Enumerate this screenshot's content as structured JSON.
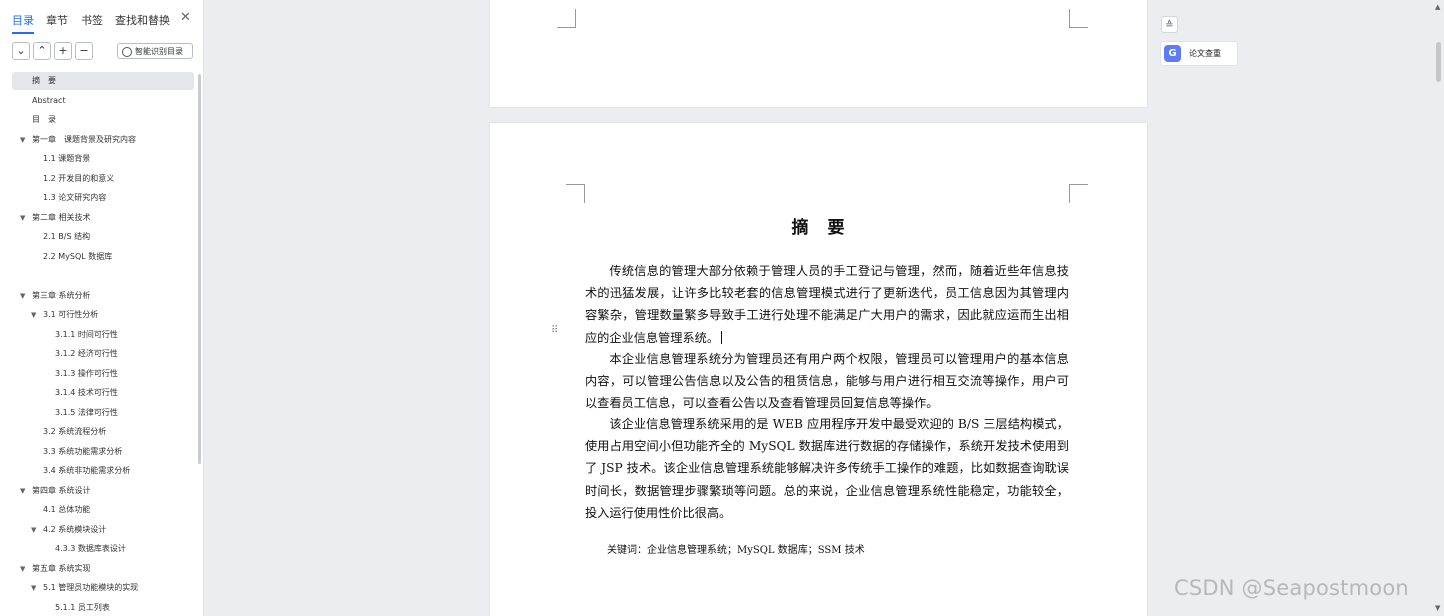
{
  "nav": {
    "tabs": [
      {
        "label": "目录",
        "active": true
      },
      {
        "label": "章节",
        "active": false
      },
      {
        "label": "书签",
        "active": false
      },
      {
        "label": "查找和替换",
        "active": false
      }
    ],
    "close_glyph": "✕",
    "toolbar": {
      "collapse_glyph": "⌄",
      "expand_glyph": "⌃",
      "add_glyph": "+",
      "remove_glyph": "−",
      "ai_toc_label": "智能识别目录"
    },
    "toc": [
      {
        "label": "摘　要",
        "level": 0,
        "selected": true,
        "arrow": false
      },
      {
        "label": "Abstract",
        "level": 0,
        "arrow": false
      },
      {
        "label": "目　录",
        "level": 0,
        "arrow": false
      },
      {
        "label": "第一章　课题背景及研究内容",
        "level": 0,
        "arrow": true
      },
      {
        "label": "1.1 课题背景",
        "level": 1,
        "arrow": false
      },
      {
        "label": "1.2 开发目的和意义",
        "level": 1,
        "arrow": false
      },
      {
        "label": "1.3 论文研究内容",
        "level": 1,
        "arrow": false
      },
      {
        "label": "第二章 相关技术",
        "level": 0,
        "arrow": true
      },
      {
        "label": "2.1 B/S 结构",
        "level": 1,
        "arrow": false
      },
      {
        "label": "2.2 MySQL 数据库",
        "level": 1,
        "arrow": false
      },
      {
        "label": "",
        "level": 0,
        "arrow": false
      },
      {
        "label": "第三章 系统分析",
        "level": 0,
        "arrow": true
      },
      {
        "label": "3.1 可行性分析",
        "level": 1,
        "arrow": true
      },
      {
        "label": "3.1.1 时间可行性",
        "level": 2,
        "arrow": false
      },
      {
        "label": "3.1.2 经济可行性",
        "level": 2,
        "arrow": false
      },
      {
        "label": "3.1.3 操作可行性",
        "level": 2,
        "arrow": false
      },
      {
        "label": "3.1.4 技术可行性",
        "level": 2,
        "arrow": false
      },
      {
        "label": "3.1.5 法律可行性",
        "level": 2,
        "arrow": false
      },
      {
        "label": "3.2 系统流程分析",
        "level": 1,
        "arrow": false
      },
      {
        "label": "3.3 系统功能需求分析",
        "level": 1,
        "arrow": false
      },
      {
        "label": "3.4 系统非功能需求分析",
        "level": 1,
        "arrow": false
      },
      {
        "label": "第四章 系统设计",
        "level": 0,
        "arrow": true
      },
      {
        "label": "4.1 总体功能",
        "level": 1,
        "arrow": false
      },
      {
        "label": "4.2 系统模块设计",
        "level": 1,
        "arrow": true
      },
      {
        "label": "4.3.3 数据库表设计",
        "level": 2,
        "arrow": false
      },
      {
        "label": "第五章 系统实现",
        "level": 0,
        "arrow": true
      },
      {
        "label": "5.1 管理员功能模块的实现",
        "level": 1,
        "arrow": true
      },
      {
        "label": "5.1.1 员工列表",
        "level": 2,
        "arrow": false
      }
    ]
  },
  "document": {
    "title": "摘　要",
    "paragraphs": [
      "传统信息的管理大部分依赖于管理人员的手工登记与管理，然而，随着近些年信息技术的迅猛发展，让许多比较老套的信息管理模式进行了更新迭代，员工信息因为其管理内容繁杂，管理数量繁多导致手工进行处理不能满足广大用户的需求，因此就应运而生出相应的企业信息管理系统。",
      "本企业信息管理系统分为管理员还有用户两个权限，管理员可以管理用户的基本信息内容，可以管理公告信息以及公告的租赁信息，能够与用户进行相互交流等操作，用户可以查看员工信息，可以查看公告以及查看管理员回复信息等操作。",
      "该企业信息管理系统采用的是 WEB 应用程序开发中最受欢迎的 B/S 三层结构模式，使用占用空间小但功能齐全的 MySQL 数据库进行数据的存储操作，系统开发技术使用到了 JSP 技术。该企业信息管理系统能够解决许多传统手工操作的难题，比如数据查询耽误时间长，数据管理步骤繁琐等问题。总的来说，企业信息管理系统性能稳定，功能较全，投入运行使用性价比很高。"
    ],
    "keywords": "关键词：企业信息管理系统；MySQL 数据库；SSM 技术"
  },
  "right_panel": {
    "collapse_glyph": "≙",
    "plagiarism_icon": "G",
    "plagiarism_label": "论文查重"
  },
  "watermark": "CSDN @Seapostmoon",
  "colors": {
    "accent": "#1f6feb",
    "plagiarism": "#5b7cf5"
  }
}
